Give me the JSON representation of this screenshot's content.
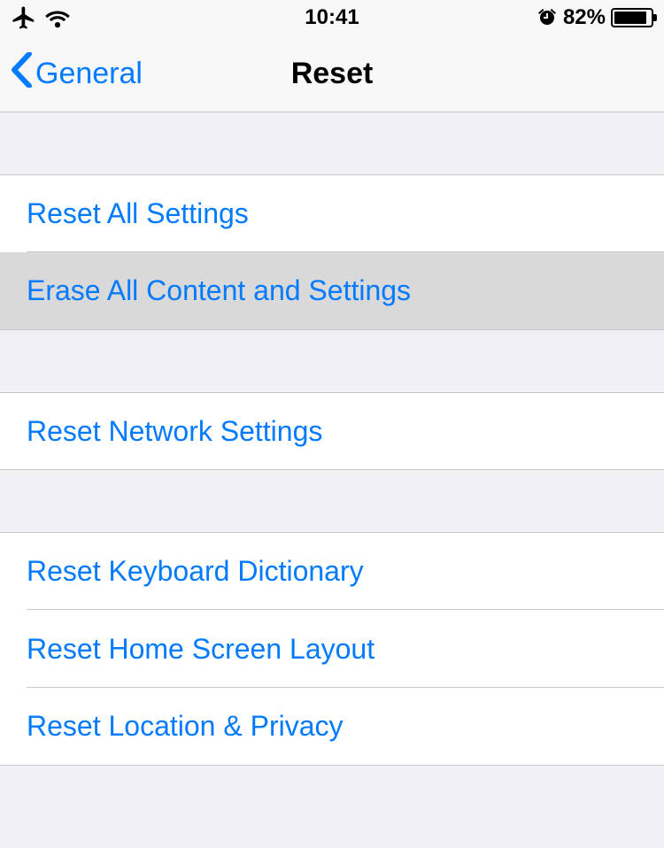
{
  "status": {
    "time": "10:41",
    "battery_pct": "82%",
    "indicators": {
      "airplane": true,
      "wifi": true,
      "alarm": true
    }
  },
  "nav": {
    "back_label": "General",
    "title": "Reset"
  },
  "group1": [
    {
      "label": "Reset All Settings",
      "highlighted": false
    },
    {
      "label": "Erase All Content and Settings",
      "highlighted": true
    }
  ],
  "group2": [
    {
      "label": "Reset Network Settings"
    }
  ],
  "group3": [
    {
      "label": "Reset Keyboard Dictionary"
    },
    {
      "label": "Reset Home Screen Layout"
    },
    {
      "label": "Reset Location & Privacy"
    }
  ]
}
